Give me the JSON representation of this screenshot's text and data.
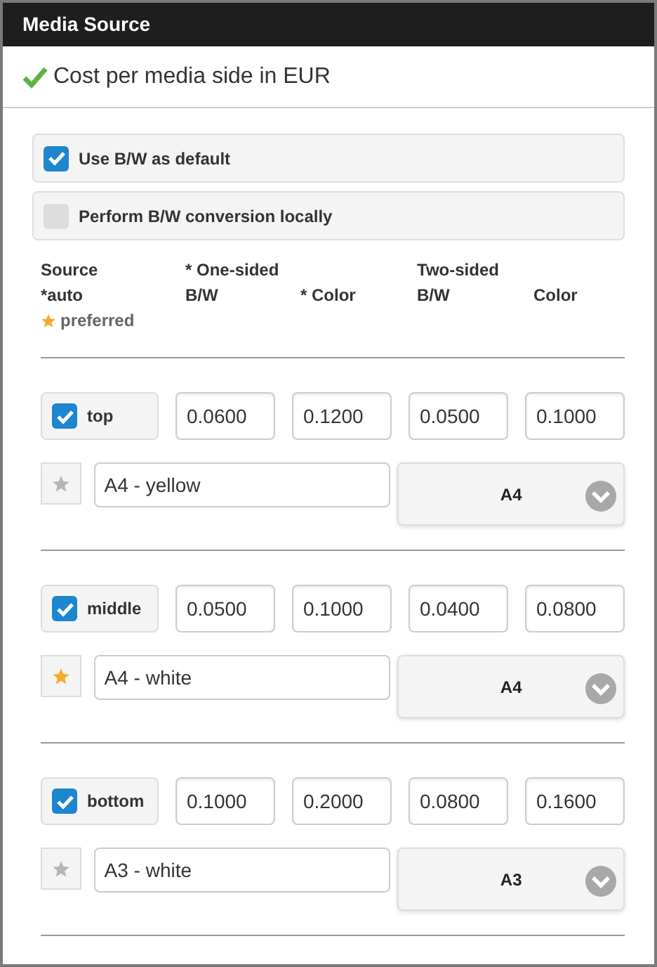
{
  "header": {
    "title": "Media Source"
  },
  "subtitle": {
    "text": "Cost per media side in EUR",
    "valid": true
  },
  "options": [
    {
      "label": "Use B/W as default",
      "checked": true
    },
    {
      "label": "Perform B/W conversion locally",
      "checked": false
    }
  ],
  "column_headers": {
    "source": "Source",
    "one_sided": "* One-sided",
    "two_sided": "Two-sided",
    "auto": "*auto",
    "preferred": "preferred",
    "one_bw": "B/W",
    "one_color": "* Color",
    "two_bw": "B/W",
    "two_color": "Color"
  },
  "sources": [
    {
      "name": "top",
      "checked": true,
      "values": [
        "0.0600",
        "0.1200",
        "0.0500",
        "0.1000"
      ],
      "preferred": false,
      "description": "A4 - yellow",
      "size": "A4"
    },
    {
      "name": "middle",
      "checked": true,
      "values": [
        "0.0500",
        "0.1000",
        "0.0400",
        "0.0800"
      ],
      "preferred": true,
      "description": "A4 - white",
      "size": "A4"
    },
    {
      "name": "bottom",
      "checked": true,
      "values": [
        "0.1000",
        "0.2000",
        "0.0800",
        "0.1600"
      ],
      "preferred": false,
      "description": "A3 - white",
      "size": "A3"
    }
  ]
}
